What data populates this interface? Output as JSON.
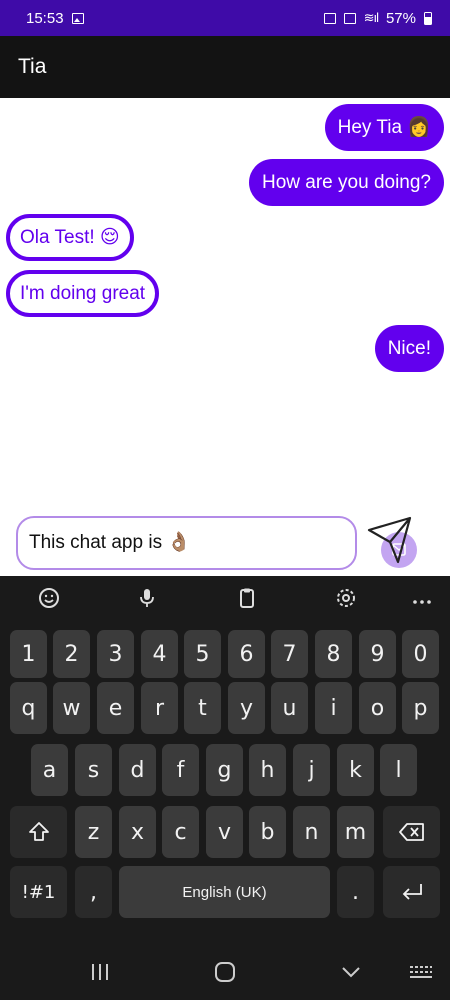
{
  "status_bar": {
    "time": "15:53",
    "battery": "57%"
  },
  "app_bar": {
    "title": "Tia"
  },
  "messages": [
    {
      "from": "me",
      "text": "Hey Tia 👩"
    },
    {
      "from": "me",
      "text": "How are you doing?"
    },
    {
      "from": "them",
      "text": "Ola Test! 😌"
    },
    {
      "from": "them",
      "text": "I'm doing great"
    },
    {
      "from": "me",
      "text": "Nice!"
    }
  ],
  "composer": {
    "value": "This chat app is 👌🏽"
  },
  "keyboard": {
    "toolbar": [
      "emoji-icon",
      "microphone-icon",
      "clipboard-icon",
      "settings-icon",
      "more-icon"
    ],
    "row_numbers": [
      "1",
      "2",
      "3",
      "4",
      "5",
      "6",
      "7",
      "8",
      "9",
      "0"
    ],
    "row_top": [
      "q",
      "w",
      "e",
      "r",
      "t",
      "y",
      "u",
      "i",
      "o",
      "p"
    ],
    "row_mid": [
      "a",
      "s",
      "d",
      "f",
      "g",
      "h",
      "j",
      "k",
      "l"
    ],
    "row_bottom": [
      "z",
      "x",
      "c",
      "v",
      "b",
      "n",
      "m"
    ],
    "symbols": "!#1",
    "comma": ",",
    "space": "English (UK)",
    "period": "."
  },
  "colors": {
    "accent": "#6200ee",
    "status_bar": "#3f0ba8",
    "app_bar": "#131313"
  }
}
